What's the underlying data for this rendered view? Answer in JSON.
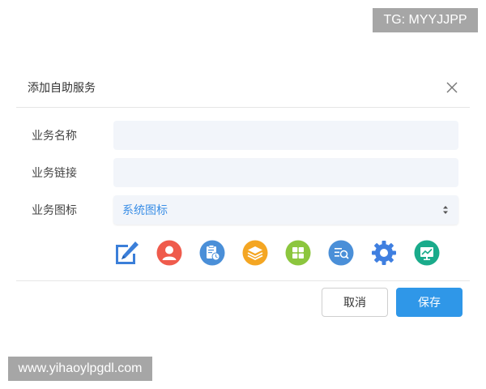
{
  "watermarks": {
    "top": "TG: MYYJJPP",
    "bottom": "www.yihaoylpgdl.com"
  },
  "dialog": {
    "title": "添加自助服务",
    "close_icon": "close-icon",
    "fields": {
      "name": {
        "label": "业务名称",
        "value": "",
        "placeholder": ""
      },
      "link": {
        "label": "业务链接",
        "value": "",
        "placeholder": ""
      },
      "icon": {
        "label": "业务图标",
        "selected": "系统图标"
      }
    },
    "icon_options": [
      "edit-icon",
      "user-icon",
      "clipboard-clock-icon",
      "layers-icon",
      "grid-icon",
      "search-list-icon",
      "gear-icon",
      "chart-icon"
    ],
    "buttons": {
      "cancel": "取消",
      "save": "保存"
    }
  },
  "colors": {
    "primary": "#2f97e8",
    "input_bg": "#f2f5fa",
    "select_text": "#3a8ee6"
  }
}
